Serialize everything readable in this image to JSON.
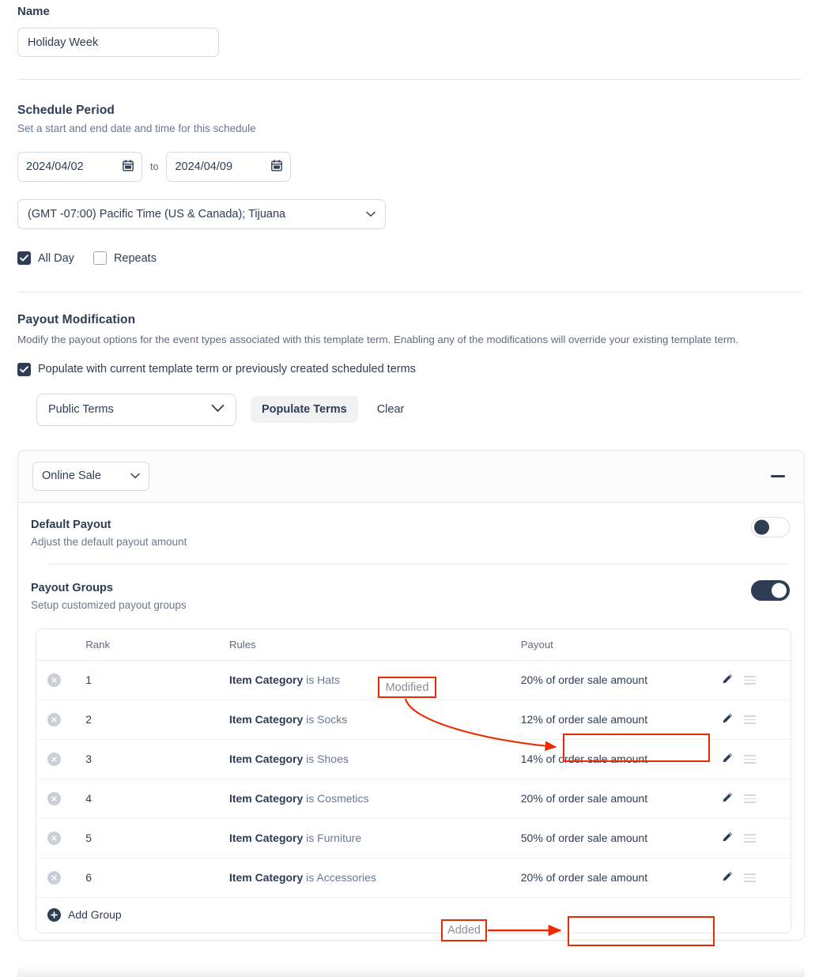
{
  "name_section": {
    "label": "Name",
    "value": "Holiday Week",
    "placeholder": "Name"
  },
  "schedule": {
    "title": "Schedule Period",
    "subtitle": "Set a start and end date and time for this schedule",
    "start_date": "2024/04/02",
    "end_date": "2024/04/09",
    "to_label": "to",
    "timezone": "(GMT -07:00) Pacific Time (US & Canada); Tijuana",
    "all_day_label": "All Day",
    "all_day_checked": true,
    "repeats_label": "Repeats",
    "repeats_checked": false
  },
  "payout_modification": {
    "title": "Payout Modification",
    "description": "Modify the payout options for the event types associated with this template term. Enabling any of the modifications will override your existing template term.",
    "populate_checkbox_label": "Populate with current template term or previously created scheduled terms",
    "populate_checked": true,
    "terms_select_value": "Public Terms",
    "populate_button": "Populate Terms",
    "clear_button": "Clear"
  },
  "card": {
    "event_type": "Online Sale",
    "collapse_icon": "minus-icon",
    "default_payout": {
      "title": "Default Payout",
      "subtitle": "Adjust the default payout amount",
      "enabled": false
    },
    "payout_groups": {
      "title": "Payout Groups",
      "subtitle": "Setup customized payout groups",
      "enabled": true,
      "columns": [
        "",
        "Rank",
        "Rules",
        "Payout",
        ""
      ],
      "rows": [
        {
          "rank": "1",
          "rule_key": "Item Category",
          "rule_rest": " is Hats",
          "payout": "20% of order sale amount"
        },
        {
          "rank": "2",
          "rule_key": "Item Category",
          "rule_rest": " is Socks",
          "payout": "12% of order sale amount"
        },
        {
          "rank": "3",
          "rule_key": "Item Category",
          "rule_rest": " is Shoes",
          "payout": "14% of order sale amount"
        },
        {
          "rank": "4",
          "rule_key": "Item Category",
          "rule_rest": " is Cosmetics",
          "payout": "20% of order sale amount"
        },
        {
          "rank": "5",
          "rule_key": "Item Category",
          "rule_rest": " is Furniture",
          "payout": "50% of order sale amount"
        },
        {
          "rank": "6",
          "rule_key": "Item Category",
          "rule_rest": " is Accessories",
          "payout": "20% of order sale amount"
        }
      ],
      "add_group_label": "Add Group"
    }
  },
  "annotations": {
    "accent_color": "#eb2a00",
    "modified_label": "Modified",
    "added_label": "Added"
  }
}
